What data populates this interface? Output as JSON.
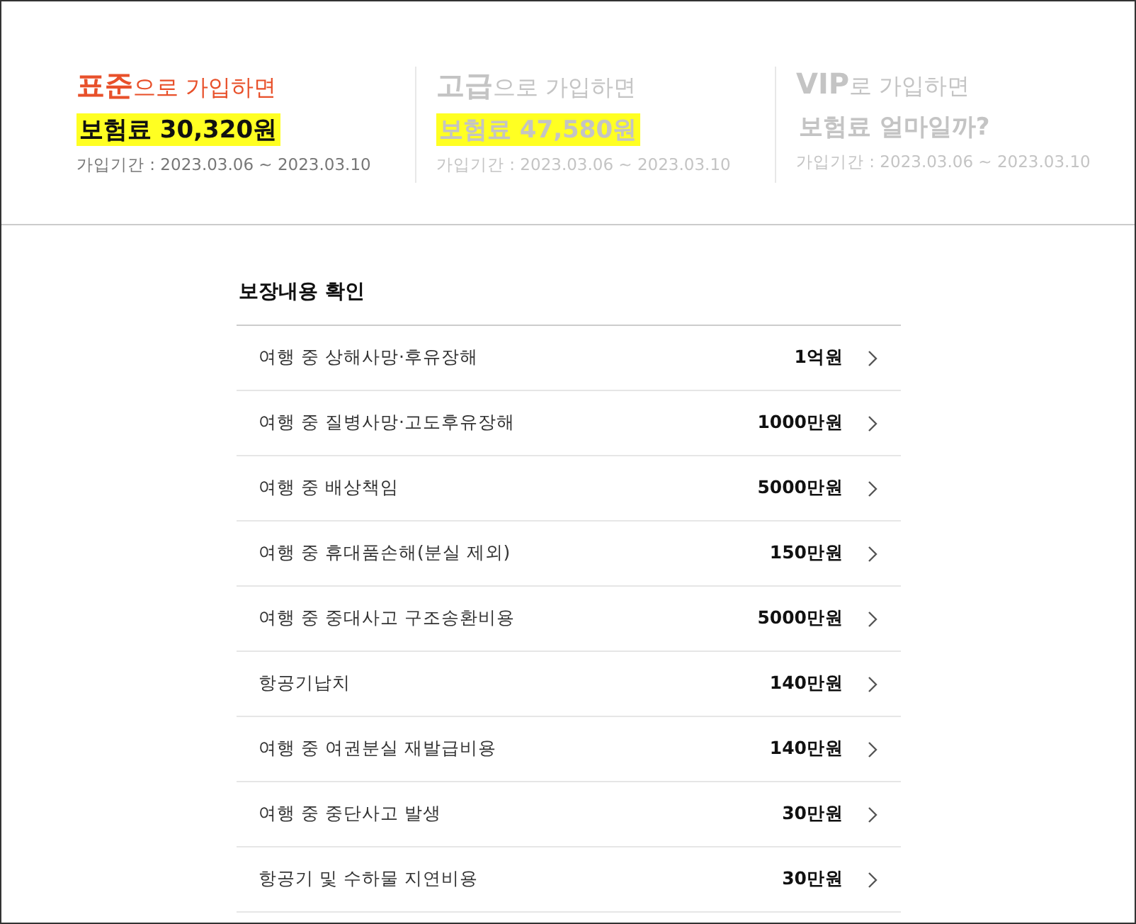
{
  "plans": [
    {
      "name": "표준",
      "suffix": "으로 가입하면",
      "price": "보험료 30,320원",
      "period": "가입기간 : 2023.03.06 ~ 2023.03.10",
      "selected": true,
      "highlighted": true
    },
    {
      "name": "고급",
      "suffix": "으로 가입하면",
      "price": "보험료 47,580원",
      "period": "가입기간 : 2023.03.06 ~ 2023.03.10",
      "selected": false,
      "highlighted": true
    },
    {
      "name": "VIP",
      "suffix": "로 가입하면",
      "price": "보험료 얼마일까?",
      "period": "가입기간 : 2023.03.06 ~ 2023.03.10",
      "selected": false,
      "highlighted": false
    }
  ],
  "coverage": {
    "title": "보장내용 확인",
    "items": [
      {
        "label": "여행 중 상해사망·후유장해",
        "amount": "1억원"
      },
      {
        "label": "여행 중 질병사망·고도후유장해",
        "amount": "1000만원"
      },
      {
        "label": "여행 중 배상책임",
        "amount": "5000만원"
      },
      {
        "label": "여행 중 휴대품손해(분실 제외)",
        "amount": "150만원"
      },
      {
        "label": "여행 중 중대사고 구조송환비용",
        "amount": "5000만원"
      },
      {
        "label": "항공기납치",
        "amount": "140만원"
      },
      {
        "label": "여행 중 여권분실 재발급비용",
        "amount": "140만원"
      },
      {
        "label": "여행 중 중단사고 발생",
        "amount": "30만원"
      },
      {
        "label": "항공기 및 수하물 지연비용",
        "amount": "30만원"
      }
    ]
  }
}
